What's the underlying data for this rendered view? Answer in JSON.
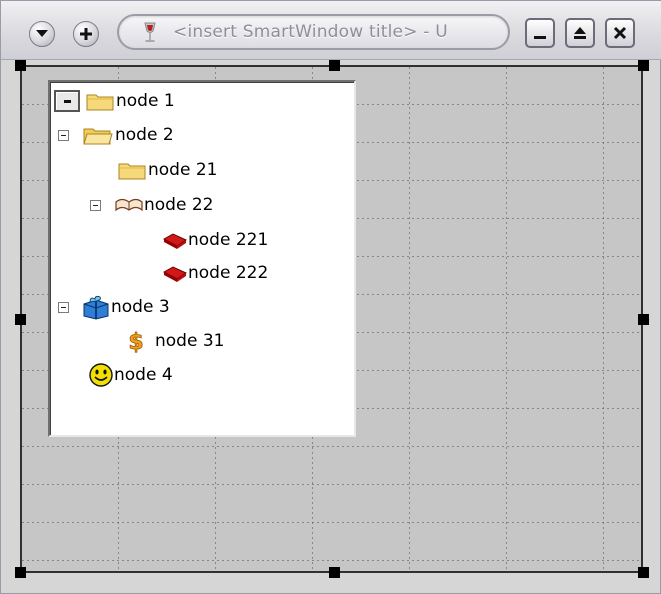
{
  "titlebar": {
    "title": "<insert SmartWindow title> - U",
    "menu_icon": "chevron-down-icon",
    "add_icon": "plus-icon",
    "app_icon": "wine-glass-icon",
    "minimize_icon": "minimize-icon",
    "maximize_icon": "maximize-icon",
    "close_icon": "close-icon"
  },
  "tree": {
    "nodes": [
      {
        "label": "node 1",
        "icon": "folder-icon",
        "level": 0,
        "expander": "selected"
      },
      {
        "label": "node 2",
        "icon": "folder-open-icon",
        "level": 0,
        "expander": "minus"
      },
      {
        "label": "node 21",
        "icon": "folder-icon",
        "level": 1,
        "expander": "none"
      },
      {
        "label": "node 22",
        "icon": "open-book-icon",
        "level": 1,
        "expander": "minus"
      },
      {
        "label": "node 221",
        "icon": "red-book-icon",
        "level": 2,
        "expander": "none"
      },
      {
        "label": "node 222",
        "icon": "red-book-icon",
        "level": 2,
        "expander": "none"
      },
      {
        "label": "node 3",
        "icon": "gift-icon",
        "level": 0,
        "expander": "minus"
      },
      {
        "label": "node 31",
        "icon": "dollar-icon",
        "level": 1,
        "expander": "none"
      },
      {
        "label": "node 4",
        "icon": "smiley-icon",
        "level": 0,
        "expander": "none"
      }
    ]
  },
  "colors": {
    "form_background": "#c6c6c6",
    "tree_background": "#ffffff",
    "handle": "#000000"
  }
}
